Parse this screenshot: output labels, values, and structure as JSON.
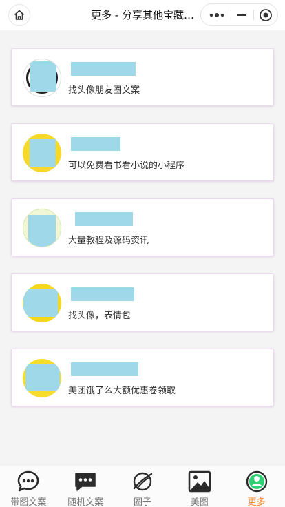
{
  "nav": {
    "title": "更多 - 分享其他宝藏…"
  },
  "items": [
    {
      "title": "",
      "desc": "找头像朋友圈文案"
    },
    {
      "title": "",
      "desc": "可以免费看书看小说的小程序"
    },
    {
      "title": "",
      "desc": "大量教程及源码资讯"
    },
    {
      "title": "",
      "desc": "找头像，表情包"
    },
    {
      "title": "",
      "desc": "美团饿了么大额优惠卷领取"
    }
  ],
  "tabbar": [
    {
      "label": "带图文案",
      "icon": "chat-bubble-icon"
    },
    {
      "label": "随机文案",
      "icon": "message-icon"
    },
    {
      "label": "圈子",
      "icon": "planet-icon"
    },
    {
      "label": "美图",
      "icon": "image-icon"
    },
    {
      "label": "更多",
      "icon": "profile-icon",
      "active": true
    }
  ],
  "colors": {
    "accent": "#f08a2e",
    "mask": "#9fd8e8",
    "active_icon": "#2fcf74"
  }
}
